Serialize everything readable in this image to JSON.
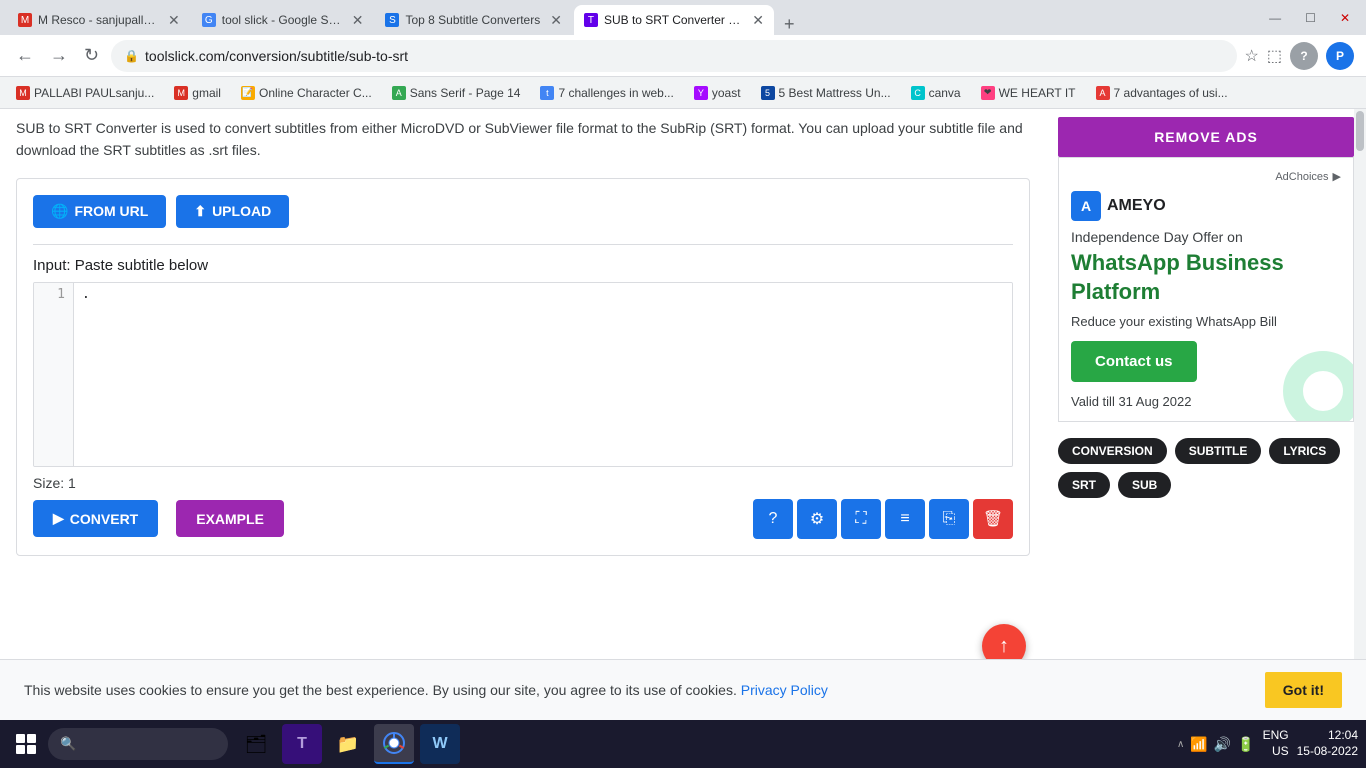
{
  "titlebar": {
    "tabs": [
      {
        "id": "tab1",
        "label": "M Resco - sanjupallabipaul@gmai...",
        "active": false,
        "favicon": "M",
        "favicon_bg": "#d93025"
      },
      {
        "id": "tab2",
        "label": "tool slick - Google Search",
        "active": false,
        "favicon": "G",
        "favicon_bg": "#4285f4"
      },
      {
        "id": "tab3",
        "label": "Top 8 Subtitle Converters",
        "active": false,
        "favicon": "S",
        "favicon_bg": "#1a73e8"
      },
      {
        "id": "tab4",
        "label": "SUB to SRT Converter - Tool Slick",
        "active": true,
        "favicon": "T",
        "favicon_bg": "#6200ea"
      }
    ],
    "window_controls": {
      "minimize": "—",
      "maximize": "☐",
      "close": "✕"
    }
  },
  "addressbar": {
    "url": "toolslick.com/conversion/subtitle/sub-to-srt",
    "back": "←",
    "forward": "→",
    "refresh": "↻"
  },
  "bookmarks": [
    {
      "label": "PALLABI PAULsanju...",
      "icon": "M",
      "icon_bg": "#d93025"
    },
    {
      "label": "gmail",
      "icon": "M",
      "icon_bg": "#d93025"
    },
    {
      "label": "Online Character C...",
      "icon": "📝",
      "icon_bg": "#f9ab00"
    },
    {
      "label": "Sans Serif - Page 14",
      "icon": "A",
      "icon_bg": "#34a853"
    },
    {
      "label": "7 challenges in web...",
      "icon": "t",
      "icon_bg": "#4285f4"
    },
    {
      "label": "yoast",
      "icon": "Y",
      "icon_bg": "#a50bff"
    },
    {
      "label": "5 Best Mattress Un...",
      "icon": "🔵",
      "icon_bg": "#0d47a1"
    },
    {
      "label": "canva",
      "icon": "C",
      "icon_bg": "#00c4cc"
    },
    {
      "label": "WE HEART IT",
      "icon": "❤",
      "icon_bg": "#ff4081"
    },
    {
      "label": "7 advantages of usi...",
      "icon": "A",
      "icon_bg": "#e53935"
    }
  ],
  "main": {
    "description": "SUB to SRT Converter is used to convert subtitles from either MicroDVD or SubViewer file format to the SubRip (SRT) format. You can upload your subtitle file and download the SRT subtitles as .srt files.",
    "btn_from_url": "FROM URL",
    "btn_upload": "UPLOAD",
    "input_label": "Input: Paste subtitle below",
    "textarea_value": ".",
    "line_number": "1",
    "size_text": "Size: 1",
    "btn_convert": "CONVERT",
    "btn_example": "EXAMPLE",
    "action_icons": {
      "help": "?",
      "settings": "⚙",
      "expand": "⛶",
      "lines": "≡",
      "copy": "⎘",
      "delete": "🗑"
    }
  },
  "sidebar": {
    "remove_ads_label": "REMOVE ADS",
    "ad": {
      "ad_choices": "AdChoices",
      "ameyo_label": "AMEYO",
      "offer_text": "Independence Day Offer on",
      "title_line1": "WhatsApp Business",
      "title_line2": "Platform",
      "description": "Reduce your existing WhatsApp Bill",
      "contact_btn": "Contact us",
      "valid_text": "Valid till 31 Aug 2022"
    },
    "tags": [
      {
        "label": "CONVERSION"
      },
      {
        "label": "SUBTITLE"
      },
      {
        "label": "LYRICS"
      },
      {
        "label": "SRT"
      },
      {
        "label": "SUB"
      }
    ]
  },
  "cookie_bar": {
    "text": "This website uses cookies to ensure you get the best experience. By using our site, you agree to its use of cookies.",
    "link_text": "Privacy Policy",
    "btn_label": "Got it!"
  },
  "taskbar": {
    "apps": [
      {
        "id": "start",
        "type": "start"
      },
      {
        "id": "search",
        "type": "search"
      },
      {
        "id": "files",
        "label": "📁"
      },
      {
        "id": "chat",
        "label": "💬"
      },
      {
        "id": "explorer",
        "label": "📂"
      },
      {
        "id": "chrome",
        "label": "🌐",
        "active": true
      },
      {
        "id": "word",
        "label": "W"
      }
    ],
    "tray": {
      "lang": "ENG\nUS",
      "time": "12:04",
      "date": "15-08-2022"
    }
  }
}
